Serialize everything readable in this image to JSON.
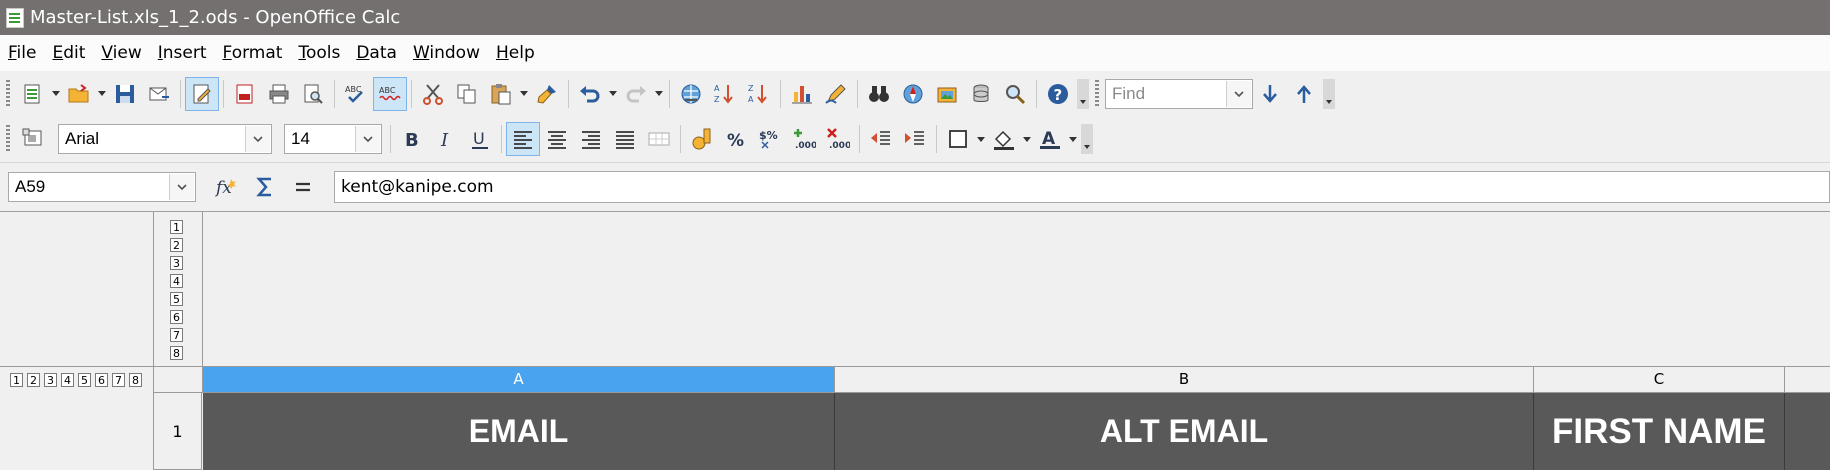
{
  "window": {
    "title": "Master-List.xls_1_2.ods - OpenOffice Calc"
  },
  "menu": [
    {
      "label": "File",
      "key": "F",
      "rest": "ile"
    },
    {
      "label": "Edit",
      "key": "E",
      "rest": "dit"
    },
    {
      "label": "View",
      "key": "V",
      "rest": "iew"
    },
    {
      "label": "Insert",
      "key": "I",
      "rest": "nsert"
    },
    {
      "label": "Format",
      "key": "F",
      "rest": "ormat",
      "pre": ""
    },
    {
      "label": "Tools",
      "key": "T",
      "rest": "ools"
    },
    {
      "label": "Data",
      "key": "D",
      "rest": "ata"
    },
    {
      "label": "Window",
      "key": "W",
      "rest": "indow"
    },
    {
      "label": "Help",
      "key": "H",
      "rest": "elp"
    }
  ],
  "toolbar": {
    "find_placeholder": "Find",
    "font_name": "Arial",
    "font_size": "14"
  },
  "formula_bar": {
    "name_box": "A59",
    "content": "kent@kanipe.com"
  },
  "outline": {
    "row_levels": [
      "1",
      "2",
      "3",
      "4",
      "5",
      "6",
      "7",
      "8"
    ],
    "col_levels": [
      "1",
      "2",
      "3",
      "4",
      "5",
      "6",
      "7",
      "8"
    ]
  },
  "columns": [
    {
      "letter": "A",
      "selected": true
    },
    {
      "letter": "B",
      "selected": false
    },
    {
      "letter": "C",
      "selected": false
    }
  ],
  "rows": [
    {
      "number": "1",
      "cells": [
        "EMAIL",
        "ALT EMAIL",
        "FIRST NAME"
      ]
    }
  ],
  "colors": {
    "title_bar": "#757070",
    "header_cell": "#595959",
    "selected_col": "#4aa3ef"
  }
}
